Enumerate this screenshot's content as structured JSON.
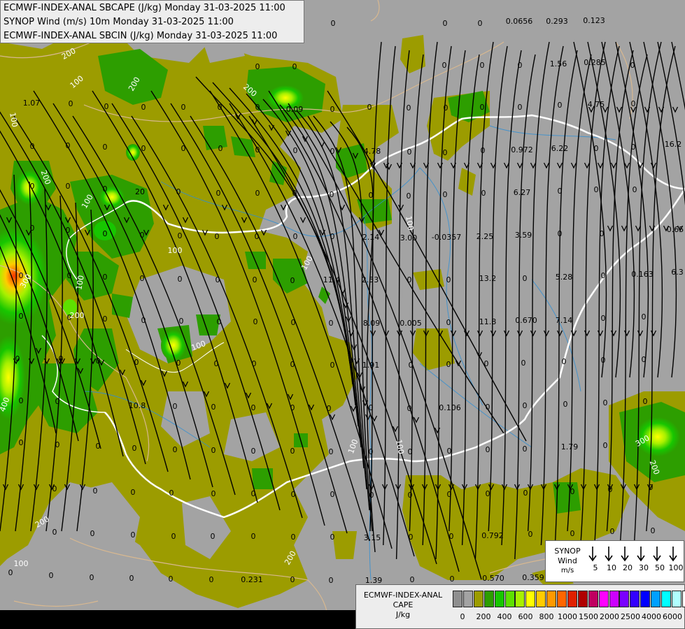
{
  "titles": {
    "line1": "ECMWF-INDEX-ANAL SBCAPE (J/kg) Monday 31-03-2025 11:00",
    "line2": "SYNOP Wind (m/s) 10m Monday 31-03-2025 11:00",
    "line3": "ECMWF-INDEX-ANAL SBCIN (J/kg) Monday 31-03-2025 11:00"
  },
  "synop_legend": {
    "title": "SYNOP",
    "subtitle": "Wind",
    "unit": "m/s",
    "speeds": [
      "5",
      "10",
      "20",
      "30",
      "50",
      "100"
    ]
  },
  "cape_legend": {
    "title": "ECMWF-INDEX-ANAL",
    "subtitle": "CAPE",
    "unit": "J/kg",
    "colors": [
      "#8f8f8f",
      "#a3a3a3",
      "#9c9c00",
      "#2d9e00",
      "#17c600",
      "#5ee000",
      "#a8f000",
      "#ffff00",
      "#ffcc00",
      "#ff9900",
      "#ff6600",
      "#e02000",
      "#b00000",
      "#c00060",
      "#ff00ff",
      "#cc00ff",
      "#7a00ff",
      "#3300ff",
      "#0000ff",
      "#00a0ff",
      "#00ffff",
      "#b0ffff",
      "#ffffff"
    ],
    "tick_labels": [
      "0",
      "200",
      "400",
      "600",
      "800",
      "1000",
      "1500",
      "2000",
      "2500",
      "4000",
      "6000"
    ]
  },
  "cin_values": [
    [
      "0",
      476,
      37
    ],
    [
      "0",
      636,
      37
    ],
    [
      "0",
      686,
      37
    ],
    [
      "0.0656",
      742,
      34
    ],
    [
      "0.293",
      796,
      34
    ],
    [
      "0.123",
      849,
      33
    ],
    [
      "1.07",
      45,
      151
    ],
    [
      "0",
      101,
      152
    ],
    [
      "0",
      152,
      156
    ],
    [
      "0",
      205,
      157
    ],
    [
      "0",
      262,
      157
    ],
    [
      "0",
      368,
      99
    ],
    [
      "0",
      421,
      99
    ],
    [
      "0",
      635,
      97
    ],
    [
      "0",
      689,
      97
    ],
    [
      "0",
      743,
      97
    ],
    [
      "1.56",
      798,
      95
    ],
    [
      "0.285",
      850,
      93
    ],
    [
      "0",
      904,
      97
    ],
    [
      "0",
      314,
      157
    ],
    [
      "0",
      368,
      157
    ],
    [
      "0.09",
      421,
      160
    ],
    [
      "0",
      475,
      160
    ],
    [
      "0",
      528,
      157
    ],
    [
      "0",
      584,
      158
    ],
    [
      "0",
      637,
      158
    ],
    [
      "0",
      689,
      157
    ],
    [
      "0",
      743,
      157
    ],
    [
      "0",
      800,
      154
    ],
    [
      "4.75",
      852,
      153
    ],
    [
      "0",
      905,
      152
    ],
    [
      "0",
      46,
      213
    ],
    [
      "0",
      97,
      212
    ],
    [
      "0",
      150,
      214
    ],
    [
      "0",
      205,
      216
    ],
    [
      "0",
      262,
      216
    ],
    [
      "0",
      315,
      216
    ],
    [
      "0",
      368,
      218
    ],
    [
      "0",
      422,
      219
    ],
    [
      "0",
      475,
      220
    ],
    [
      "4.78",
      532,
      220
    ],
    [
      "0",
      585,
      221
    ],
    [
      "0",
      636,
      222
    ],
    [
      "0",
      690,
      219
    ],
    [
      "0.972",
      746,
      218
    ],
    [
      "6.22",
      800,
      216
    ],
    [
      "0",
      852,
      216
    ],
    [
      "0",
      905,
      214
    ],
    [
      "16.2",
      962,
      210
    ],
    [
      "0",
      46,
      270
    ],
    [
      "0",
      97,
      270
    ],
    [
      "0",
      150,
      274
    ],
    [
      "20",
      200,
      278
    ],
    [
      "0",
      255,
      278
    ],
    [
      "0",
      312,
      280
    ],
    [
      "0",
      368,
      280
    ],
    [
      "0",
      421,
      280
    ],
    [
      "0",
      474,
      282
    ],
    [
      "0",
      530,
      283
    ],
    [
      "0",
      584,
      284
    ],
    [
      "0",
      636,
      282
    ],
    [
      "0",
      691,
      280
    ],
    [
      "6.27",
      746,
      279
    ],
    [
      "0",
      800,
      277
    ],
    [
      "0",
      852,
      275
    ],
    [
      "0",
      907,
      275
    ],
    [
      "0",
      46,
      330
    ],
    [
      "0",
      97,
      333
    ],
    [
      "0",
      150,
      338
    ],
    [
      "0",
      203,
      340
    ],
    [
      "0",
      257,
      341
    ],
    [
      "0",
      310,
      342
    ],
    [
      "0",
      367,
      342
    ],
    [
      "0",
      422,
      342
    ],
    [
      "0",
      475,
      342
    ],
    [
      "2.14",
      530,
      343
    ],
    [
      "3.00",
      584,
      344
    ],
    [
      "-0.0357",
      638,
      343
    ],
    [
      "2.25",
      693,
      342
    ],
    [
      "3.59",
      748,
      340
    ],
    [
      "0",
      800,
      338
    ],
    [
      "0",
      860,
      338
    ],
    [
      "0.65",
      965,
      332
    ],
    [
      "0",
      30,
      398
    ],
    [
      "0",
      99,
      398
    ],
    [
      "0",
      150,
      400
    ],
    [
      "0",
      203,
      402
    ],
    [
      "0",
      257,
      403
    ],
    [
      "0",
      311,
      404
    ],
    [
      "0",
      364,
      404
    ],
    [
      "0",
      418,
      405
    ],
    [
      "11.4",
      474,
      404
    ],
    [
      "2.53",
      529,
      404
    ],
    [
      "0",
      585,
      404
    ],
    [
      "0",
      641,
      404
    ],
    [
      "13.2",
      697,
      402
    ],
    [
      "0",
      750,
      402
    ],
    [
      "5.28",
      806,
      400
    ],
    [
      "0",
      862,
      398
    ],
    [
      "0.163",
      918,
      396
    ],
    [
      "6.3",
      968,
      393
    ],
    [
      "0",
      30,
      456
    ],
    [
      "0",
      99,
      458
    ],
    [
      "0",
      150,
      460
    ],
    [
      "0",
      205,
      462
    ],
    [
      "0",
      259,
      463
    ],
    [
      "0",
      313,
      464
    ],
    [
      "0",
      365,
      464
    ],
    [
      "0",
      419,
      465
    ],
    [
      "0",
      473,
      466
    ],
    [
      "8.09",
      531,
      466
    ],
    [
      "0.005",
      587,
      466
    ],
    [
      "0",
      641,
      465
    ],
    [
      "11.8",
      697,
      464
    ],
    [
      "0.670",
      752,
      462
    ],
    [
      "7.14",
      806,
      462
    ],
    [
      "0",
      862,
      459
    ],
    [
      "0",
      920,
      457
    ],
    [
      "0",
      25,
      517
    ],
    [
      "0",
      87,
      517
    ],
    [
      "0",
      140,
      520
    ],
    [
      "0",
      195,
      522
    ],
    [
      "0",
      255,
      523
    ],
    [
      "0",
      309,
      524
    ],
    [
      "0",
      363,
      524
    ],
    [
      "0",
      418,
      525
    ],
    [
      "0",
      475,
      526
    ],
    [
      "1.91",
      530,
      526
    ],
    [
      "0",
      587,
      526
    ],
    [
      "0",
      641,
      525
    ],
    [
      "0",
      695,
      524
    ],
    [
      "0",
      748,
      523
    ],
    [
      "0",
      806,
      521
    ],
    [
      "0",
      862,
      519
    ],
    [
      "0",
      920,
      518
    ],
    [
      "0",
      30,
      577
    ],
    [
      "0",
      82,
      578
    ],
    [
      "10.8",
      196,
      584
    ],
    [
      "0",
      250,
      585
    ],
    [
      "0",
      305,
      586
    ],
    [
      "0",
      362,
      587
    ],
    [
      "0",
      418,
      587
    ],
    [
      "0",
      470,
      588
    ],
    [
      "0",
      530,
      587
    ],
    [
      "0",
      585,
      588
    ],
    [
      "0.106",
      643,
      587
    ],
    [
      "0",
      697,
      586
    ],
    [
      "0",
      750,
      584
    ],
    [
      "0",
      808,
      582
    ],
    [
      "0",
      865,
      580
    ],
    [
      "0",
      922,
      578
    ],
    [
      "0",
      30,
      637
    ],
    [
      "0",
      82,
      640
    ],
    [
      "0",
      140,
      642
    ],
    [
      "0",
      192,
      645
    ],
    [
      "0",
      250,
      647
    ],
    [
      "0",
      305,
      648
    ],
    [
      "0",
      362,
      649
    ],
    [
      "0",
      418,
      649
    ],
    [
      "0",
      473,
      650
    ],
    [
      "0",
      530,
      650
    ],
    [
      "0",
      586,
      650
    ],
    [
      "0",
      642,
      649
    ],
    [
      "0",
      697,
      647
    ],
    [
      "0",
      750,
      646
    ],
    [
      "1.79",
      814,
      643
    ],
    [
      "0",
      865,
      641
    ],
    [
      "0",
      78,
      703
    ],
    [
      "0",
      136,
      706
    ],
    [
      "0",
      190,
      708
    ],
    [
      "0",
      245,
      709
    ],
    [
      "0",
      305,
      710
    ],
    [
      "0",
      362,
      710
    ],
    [
      "0",
      419,
      711
    ],
    [
      "0",
      475,
      711
    ],
    [
      "0",
      531,
      712
    ],
    [
      "0",
      586,
      712
    ],
    [
      "0",
      642,
      711
    ],
    [
      "0",
      697,
      710
    ],
    [
      "0",
      751,
      709
    ],
    [
      "0",
      818,
      707
    ],
    [
      "0",
      872,
      704
    ],
    [
      "0",
      930,
      701
    ],
    [
      "0",
      78,
      765
    ],
    [
      "0",
      132,
      767
    ],
    [
      "0",
      190,
      769
    ],
    [
      "0",
      248,
      771
    ],
    [
      "0",
      304,
      771
    ],
    [
      "0",
      362,
      771
    ],
    [
      "0",
      419,
      772
    ],
    [
      "0",
      475,
      772
    ],
    [
      "3.15",
      532,
      773
    ],
    [
      "0",
      587,
      772
    ],
    [
      "0",
      645,
      771
    ],
    [
      "0.792",
      704,
      770
    ],
    [
      "0",
      758,
      768
    ],
    [
      "0",
      818,
      767
    ],
    [
      "0",
      875,
      764
    ],
    [
      "0",
      933,
      763
    ],
    [
      "0",
      15,
      823
    ],
    [
      "0",
      73,
      827
    ],
    [
      "0",
      131,
      830
    ],
    [
      "0",
      188,
      831
    ],
    [
      "0",
      244,
      832
    ],
    [
      "0",
      302,
      833
    ],
    [
      "0.231",
      360,
      833
    ],
    [
      "0",
      418,
      833
    ],
    [
      "0",
      473,
      834
    ],
    [
      "1.39",
      534,
      834
    ],
    [
      "0",
      589,
      833
    ],
    [
      "0",
      646,
      832
    ],
    [
      "0.570",
      705,
      831
    ],
    [
      "0.359",
      762,
      830
    ]
  ],
  "cape_contour_labels": [
    [
      "200",
      100,
      80,
      -30
    ],
    [
      "100",
      112,
      120,
      -40
    ],
    [
      "100",
      16,
      172,
      80
    ],
    [
      "200",
      195,
      122,
      -60
    ],
    [
      "200",
      355,
      132,
      40
    ],
    [
      "100",
      128,
      290,
      -60
    ],
    [
      "200",
      62,
      255,
      70
    ],
    [
      "100",
      250,
      362,
      0
    ],
    [
      "300",
      40,
      404,
      -60
    ],
    [
      "100",
      118,
      405,
      -80
    ],
    [
      "400",
      10,
      580,
      -70
    ],
    [
      "200",
      62,
      750,
      -30
    ],
    [
      "200",
      110,
      455,
      0
    ],
    [
      "100",
      285,
      498,
      -20
    ],
    [
      "100",
      582,
      320,
      80
    ],
    [
      "100",
      442,
      378,
      -60
    ],
    [
      "100",
      568,
      640,
      80
    ],
    [
      "100",
      508,
      640,
      -70
    ],
    [
      "200",
      418,
      800,
      -60
    ],
    [
      "300",
      920,
      634,
      -30
    ],
    [
      "200",
      932,
      670,
      70
    ],
    [
      "100",
      30,
      810,
      0
    ]
  ]
}
